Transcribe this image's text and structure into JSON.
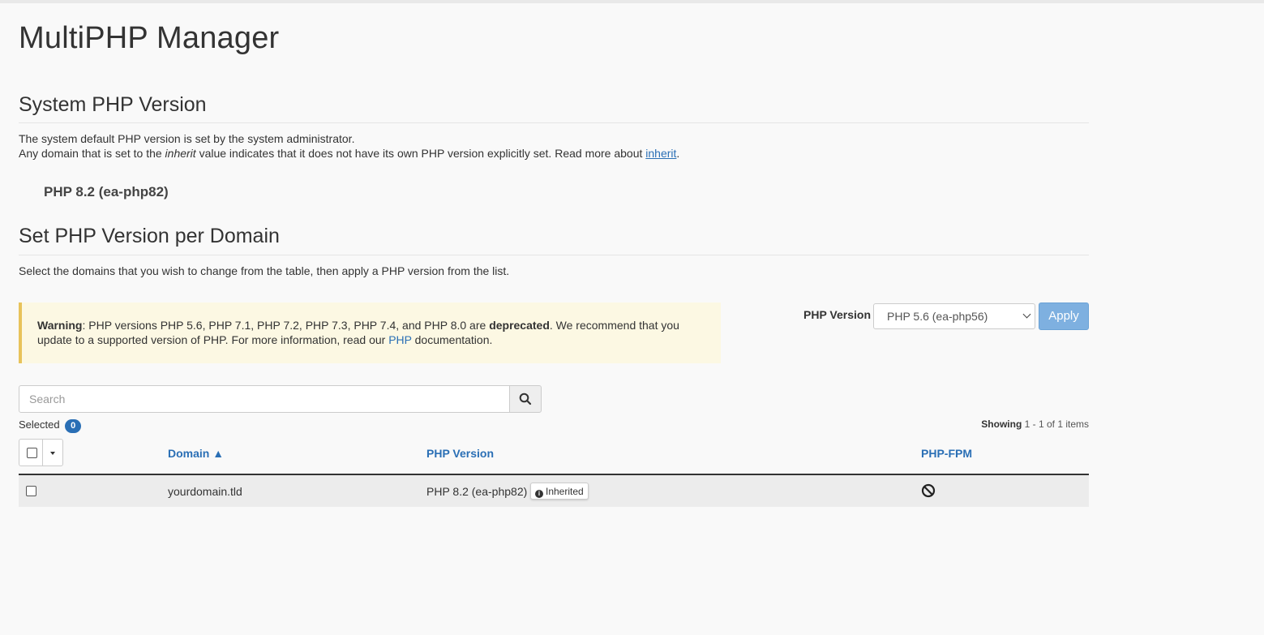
{
  "page": {
    "title": "MultiPHP Manager"
  },
  "system": {
    "heading": "System PHP Version",
    "line1": "The system default PHP version is set by the system administrator.",
    "line2_a": "Any domain that is set to the ",
    "line2_em": "inherit",
    "line2_b": " value indicates that it does not have its own PHP version explicitly set. Read more about ",
    "line2_link": "inherit",
    "line2_end": ".",
    "version": "PHP 8.2 (ea-php82)"
  },
  "per_domain": {
    "heading": "Set PHP Version per Domain",
    "description": "Select the domains that you wish to change from the table, then apply a PHP version from the list."
  },
  "warning": {
    "label": "Warning",
    "text_a": ": PHP versions PHP 5.6, PHP 7.1, PHP 7.2, PHP 7.3, PHP 7.4, and PHP 8.0 are ",
    "emphasis": "deprecated",
    "text_b": ". We recommend that you update to a supported version of PHP. For more information, read our ",
    "link": "PHP",
    "text_c": " documentation."
  },
  "php_select": {
    "label": "PHP Version",
    "selected": "PHP 5.6 (ea-php56)",
    "apply_label": "Apply"
  },
  "search": {
    "placeholder": "Search"
  },
  "selection": {
    "label": "Selected",
    "count": "0"
  },
  "paging": {
    "showing_label": "Showing",
    "range": "1 - 1 of 1 items"
  },
  "table": {
    "columns": {
      "domain": "Domain ▲",
      "php_version": "PHP Version",
      "php_fpm": "PHP-FPM"
    },
    "rows": [
      {
        "domain": "yourdomain.tld",
        "php_version": "PHP 8.2 (ea-php82)",
        "badge": "Inherited",
        "fpm_icon": "ban-icon"
      }
    ]
  },
  "colors": {
    "link": "#2a6fb5",
    "warning_bg": "#fcf8e3",
    "apply_bg": "#7eb0e0"
  }
}
